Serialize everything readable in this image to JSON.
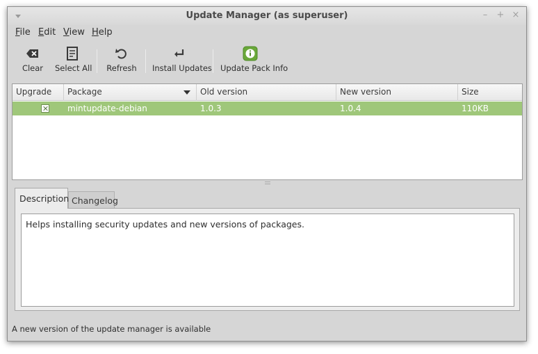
{
  "window": {
    "title": "Update Manager (as superuser)"
  },
  "menubar": {
    "items": [
      {
        "label": "File",
        "underline": "F",
        "rest": "ile"
      },
      {
        "label": "Edit",
        "underline": "E",
        "rest": "dit"
      },
      {
        "label": "View",
        "underline": "V",
        "rest": "iew"
      },
      {
        "label": "Help",
        "underline": "H",
        "rest": "elp"
      }
    ]
  },
  "toolbar": {
    "clear_label": "Clear",
    "select_all_label": "Select All",
    "refresh_label": "Refresh",
    "install_label": "Install Updates",
    "pack_info_label": "Update Pack Info",
    "icons": {
      "clear": "backspace-icon",
      "select_all": "list-icon",
      "refresh": "refresh-icon",
      "install": "return-arrow-icon",
      "pack_info": "info-icon"
    },
    "info_icon_color": "#6aa83a"
  },
  "packages": {
    "columns": [
      "Upgrade",
      "Package",
      "Old version",
      "New version",
      "Size"
    ],
    "rows": [
      {
        "upgrade": true,
        "package": "mintupdate-debian",
        "old_version": "1.0.3",
        "new_version": "1.0.4",
        "size": "110KB"
      }
    ],
    "selected_row_color": "#9fc77a"
  },
  "tabs": [
    {
      "label": "Description",
      "active": true
    },
    {
      "label": "Changelog",
      "active": false
    }
  ],
  "description": {
    "text": "Helps installing security updates and new versions of packages."
  },
  "status": {
    "text": "A new version of the update manager is available"
  }
}
